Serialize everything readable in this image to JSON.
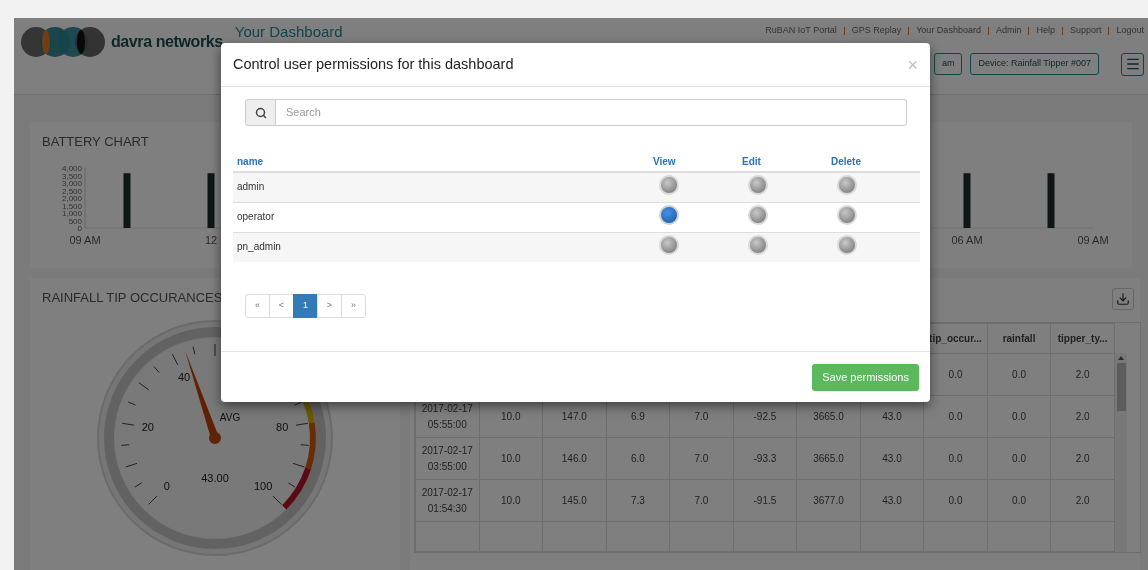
{
  "header": {
    "brand": "davra networks",
    "title": "Your Dashboard",
    "nav": [
      "RuBAN IoT Portal",
      "GPS Replay",
      "Your Dashboard",
      "Admin",
      "Help",
      "Support",
      "Logout"
    ],
    "buttons": [
      "am",
      "Device: Rainfall Tipper #007"
    ]
  },
  "battery_chart": {
    "title": "BATTERY CHART",
    "chart_data": {
      "type": "bar",
      "categories": [
        "09 AM",
        null,
        null,
        "12",
        null,
        null,
        null,
        null,
        null,
        null,
        null,
        null,
        null,
        null,
        null,
        null,
        null,
        null,
        null,
        null,
        null,
        "06 AM",
        null,
        null,
        "09 AM"
      ],
      "values": [
        null,
        3650,
        null,
        3650,
        null,
        null,
        null,
        null,
        null,
        null,
        null,
        null,
        null,
        null,
        null,
        null,
        null,
        null,
        null,
        null,
        null,
        3650,
        null,
        3650,
        null
      ],
      "ylim": [
        0,
        4000
      ],
      "yticks": [
        {
          "value": 0,
          "label": "0"
        },
        {
          "value": 500,
          "label": "500"
        },
        {
          "value": 1000,
          "label": "1,000"
        },
        {
          "value": 1500,
          "label": "1,500"
        },
        {
          "value": 2000,
          "label": "2,000"
        },
        {
          "value": 2500,
          "label": "2,500"
        },
        {
          "value": 3000,
          "label": "3,000"
        },
        {
          "value": 3500,
          "label": "3,500"
        },
        {
          "value": 4000,
          "label": "4,000"
        }
      ]
    }
  },
  "gauge": {
    "title": "RAINFALL TIP OCCURANCES",
    "labels": [
      "0",
      "20",
      "40",
      "80",
      "100"
    ],
    "caption": "AVG",
    "value": "43.00",
    "level": 0.43
  },
  "data_table": {
    "columns": [
      "tip_occur...",
      "rainfall",
      "tipper_ty..."
    ],
    "rows": [
      [
        "0.0",
        "0.0",
        "2.0"
      ],
      [
        "2017-02-17 05:55:00",
        "10.0",
        "147.0",
        "6.9",
        "7.0",
        "-92.5",
        "3665.0",
        "43.0",
        "0.0",
        "0.0",
        "2.0"
      ],
      [
        "2017-02-17 03:55:00",
        "10.0",
        "146.0",
        "6.0",
        "7.0",
        "-93.3",
        "3665.0",
        "43.0",
        "0.0",
        "0.0",
        "2.0"
      ],
      [
        "2017-02-17 01:54:30",
        "10.0",
        "145.0",
        "7.3",
        "7.0",
        "-91.5",
        "3677.0",
        "43.0",
        "0.0",
        "0.0",
        "2.0"
      ]
    ]
  },
  "modal": {
    "title": "Control user permissions for this dashboard",
    "close": "×",
    "search": {
      "placeholder": "Search"
    },
    "columns": [
      "name",
      "View",
      "Edit",
      "Delete"
    ],
    "users": [
      {
        "name": "admin",
        "view": false,
        "edit": false,
        "delete": false
      },
      {
        "name": "operator",
        "view": true,
        "edit": false,
        "delete": false
      },
      {
        "name": "pn_admin",
        "view": false,
        "edit": false,
        "delete": false
      }
    ],
    "pagination": [
      {
        "label": "«",
        "selected": false
      },
      {
        "label": "<",
        "selected": false
      },
      {
        "label": "1",
        "selected": true
      },
      {
        "label": ">",
        "selected": false
      },
      {
        "label": "»",
        "selected": false
      }
    ],
    "save_button": "Save permissions"
  }
}
